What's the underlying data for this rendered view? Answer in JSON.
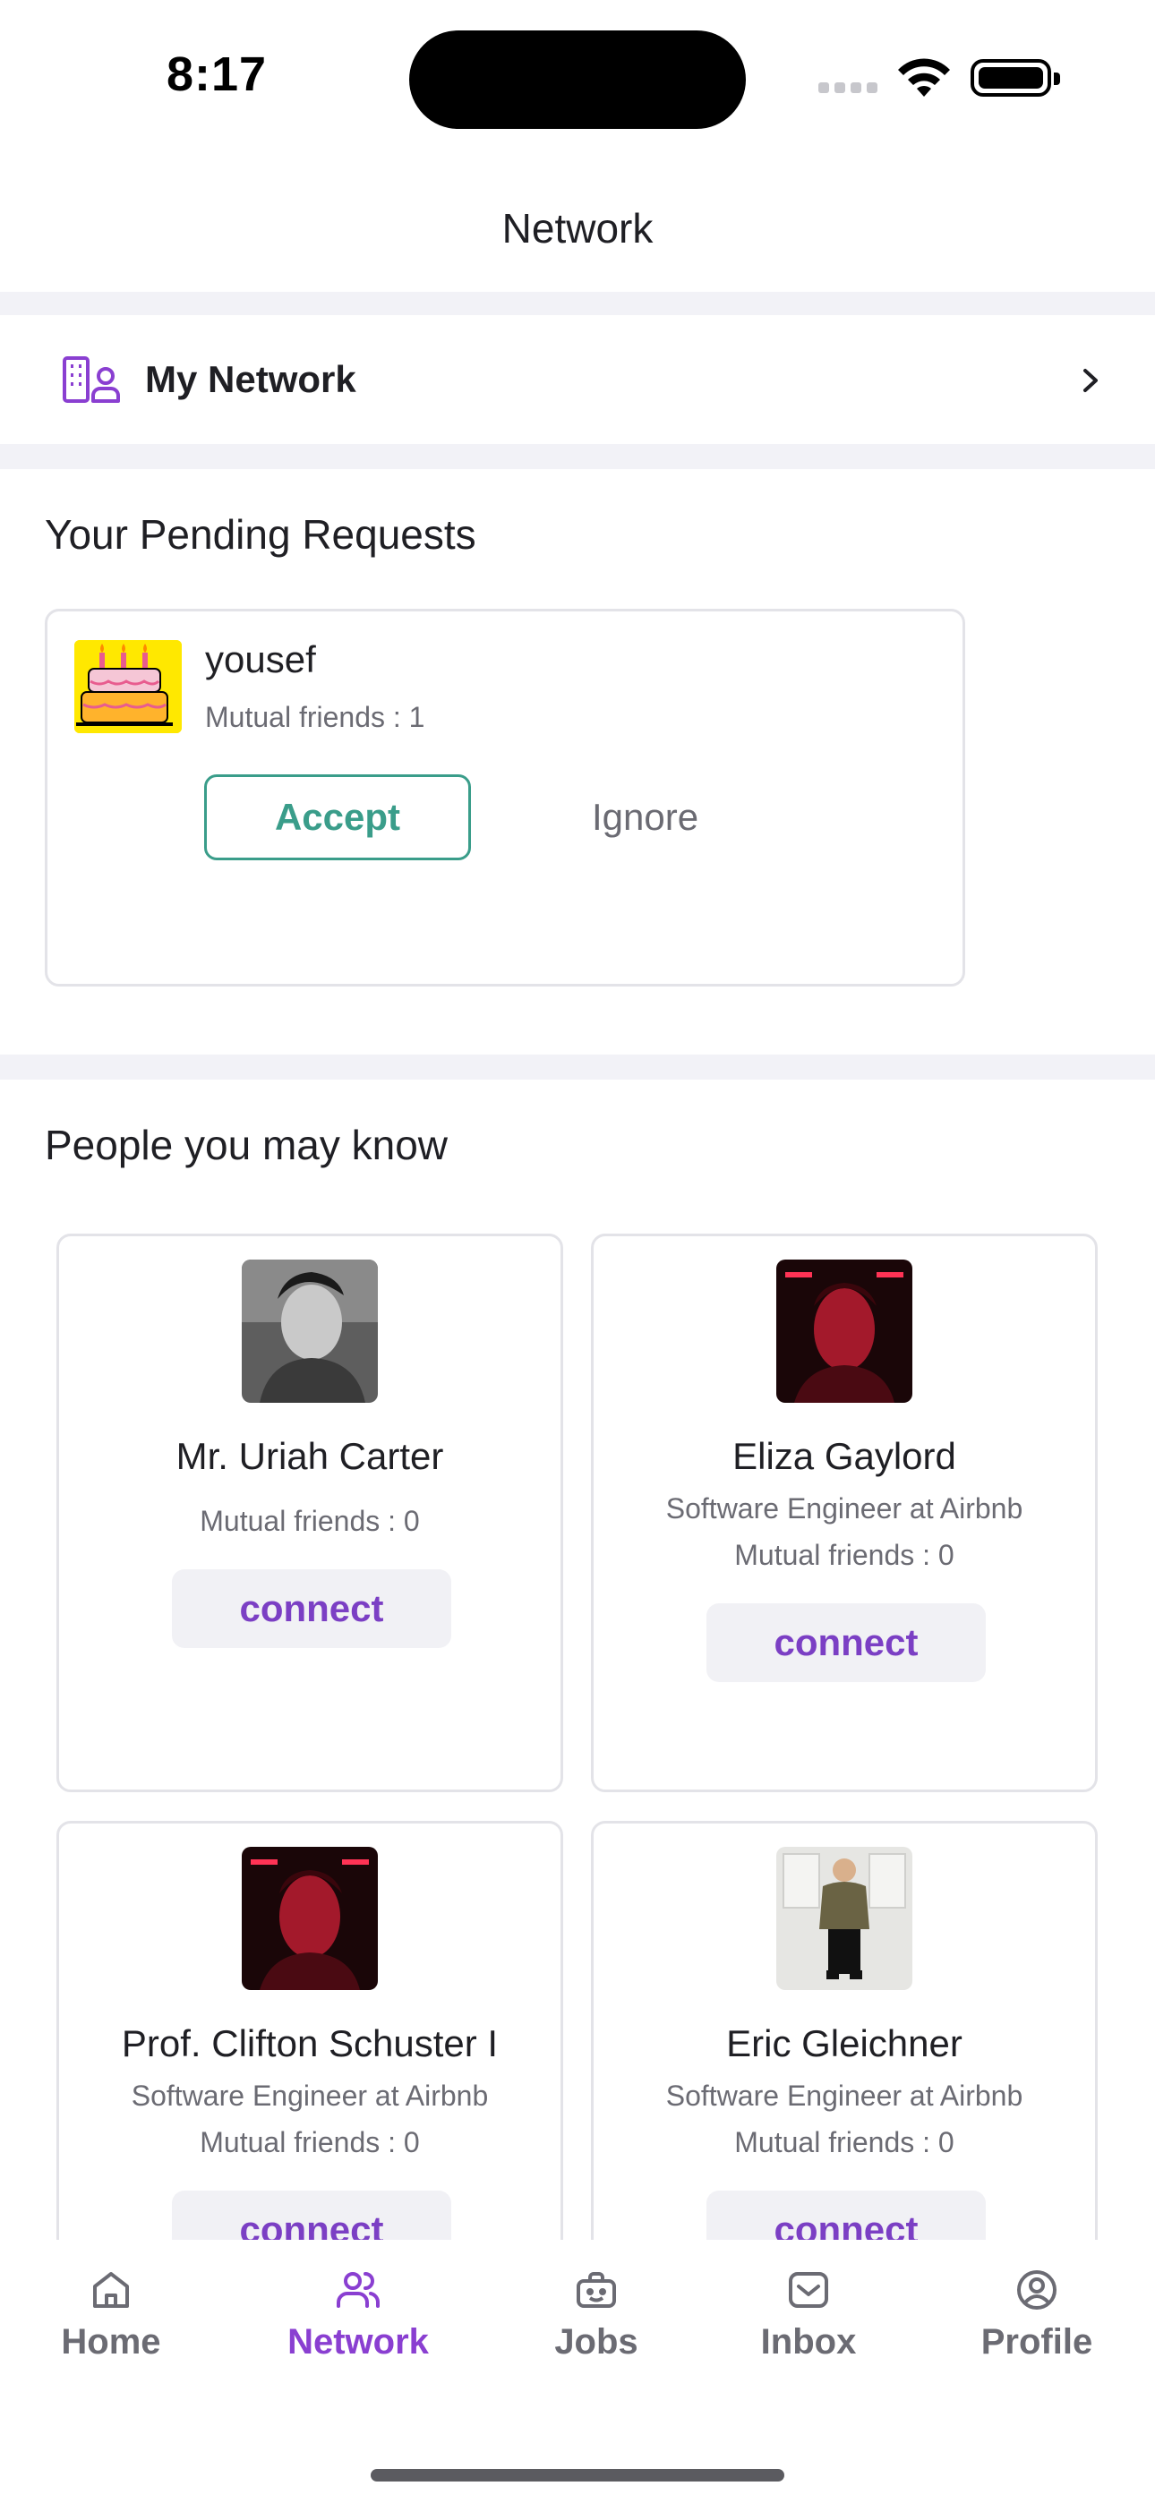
{
  "status_bar": {
    "time": "8:17"
  },
  "header": {
    "title": "Network"
  },
  "my_network": {
    "label": "My Network"
  },
  "pending": {
    "title": "Your Pending Requests",
    "request": {
      "name": "yousef",
      "mutual": "Mutual friends : 1",
      "accept_label": "Accept",
      "ignore_label": "Ignore"
    }
  },
  "people": {
    "title": "People you may know",
    "connect_label": "connect",
    "items": [
      {
        "name": "Mr. Uriah Carter",
        "subtitle": "",
        "mutual": "Mutual friends  : 0"
      },
      {
        "name": "Eliza Gaylord",
        "subtitle": "Software Engineer at Airbnb",
        "mutual": "Mutual friends  : 0"
      },
      {
        "name": "Prof. Clifton Schuster I",
        "subtitle": "Software Engineer at Airbnb",
        "mutual": "Mutual friends  : 0"
      },
      {
        "name": "Eric Gleichner",
        "subtitle": "Software Engineer at Airbnb",
        "mutual": "Mutual friends  : 0"
      }
    ]
  },
  "nav": {
    "items": [
      {
        "label": "Home",
        "icon": "home-icon"
      },
      {
        "label": "Network",
        "icon": "people-icon",
        "active": true
      },
      {
        "label": "Jobs",
        "icon": "briefcase-icon"
      },
      {
        "label": "Inbox",
        "icon": "inbox-icon"
      },
      {
        "label": "Profile",
        "icon": "user-circle-icon"
      }
    ]
  },
  "colors": {
    "accent": "#8a3fd1",
    "accept": "#3a9d8a",
    "band": "#f2f2f7"
  }
}
